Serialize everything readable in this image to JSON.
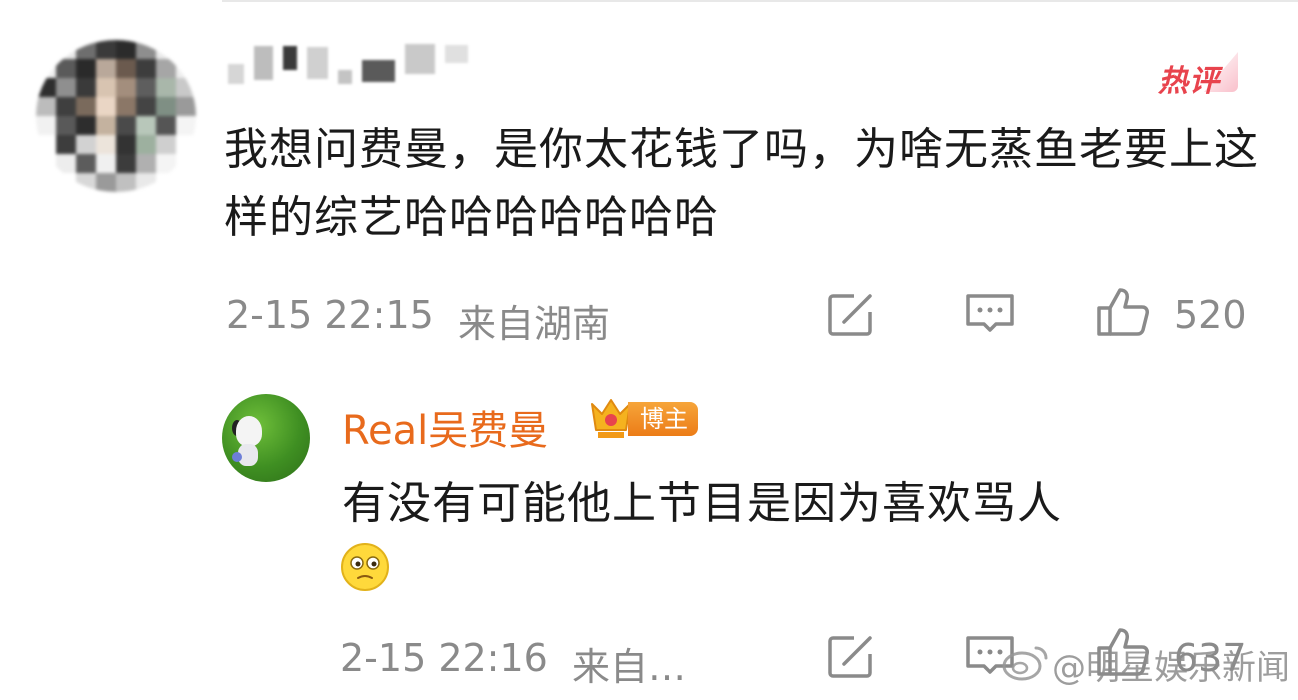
{
  "main_comment": {
    "badge": "热评",
    "text": "我想问费曼，是你太花钱了吗，为啥无蒸鱼老要上这样的综艺哈哈哈哈哈哈哈",
    "time": "2-15 22:15",
    "location": "来自湖南",
    "like_count": "520"
  },
  "reply": {
    "author": "Real吴费曼",
    "author_tag": "博主",
    "text": "有没有可能他上节目是因为喜欢骂人",
    "time": "2-15 22:16",
    "location": "来自…",
    "like_count": "637"
  },
  "watermark": "@明星娱乐新闻",
  "colors": {
    "hot": "#e8434d",
    "author": "#e86a1c",
    "meta": "#8a8a8a",
    "text": "#1a1a1a"
  },
  "icons": [
    "edit-icon",
    "comment-icon",
    "thumbs-up-icon",
    "crown-icon",
    "emoji-icon",
    "weibo-icon"
  ]
}
